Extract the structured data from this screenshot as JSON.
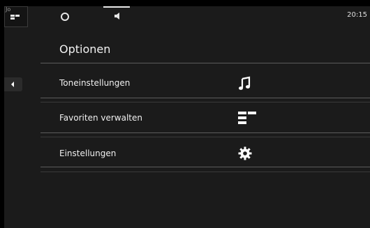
{
  "status_bar": {
    "time": "20:15",
    "icons": [
      "app-grid-icon",
      "ring-status-icon",
      "speaker-icon"
    ]
  },
  "page": {
    "title": "Optionen"
  },
  "menu": {
    "items": [
      {
        "label": "Toneinstellungen",
        "icon": "music-note-icon"
      },
      {
        "label": "Favoriten verwalten",
        "icon": "favorites-grid-icon"
      },
      {
        "label": "Einstellungen",
        "icon": "gear-icon"
      }
    ]
  },
  "colors": {
    "background": "#1b1b1b",
    "divider": "#5c5c5c",
    "text": "#f0f0f0"
  }
}
